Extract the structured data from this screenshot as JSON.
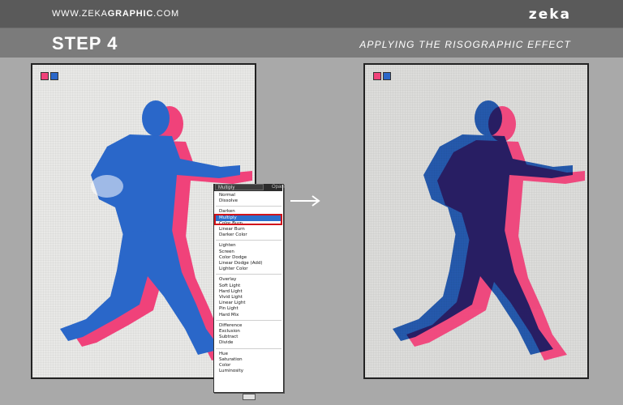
{
  "header": {
    "site_prefix": "WWW.ZEKA",
    "site_bold": "GRAPHIC",
    "site_suffix": ".COM",
    "logo": "zeka"
  },
  "step": {
    "title": "STEP 4",
    "subtitle": "APPLYING THE RISOGRAPHIC EFFECT"
  },
  "panels": {
    "left": {
      "swatch_colors": [
        "#f0427a",
        "#2a67c9"
      ]
    },
    "right": {
      "swatch_colors": [
        "#f0427a",
        "#2a67c9"
      ]
    }
  },
  "blend_menu": {
    "selected": "Multiply",
    "opacity_label": "Opaci",
    "groups": [
      [
        "Normal",
        "Dissolve"
      ],
      [
        "Darken",
        "Multiply",
        "Color Burn",
        "Linear Burn",
        "Darker Color"
      ],
      [
        "Lighten",
        "Screen",
        "Color Dodge",
        "Linear Dodge (Add)",
        "Lighter Color"
      ],
      [
        "Overlay",
        "Soft Light",
        "Hard Light",
        "Vivid Light",
        "Linear Light",
        "Pin Light",
        "Hard Mix"
      ],
      [
        "Difference",
        "Exclusion",
        "Subtract",
        "Divide"
      ],
      [
        "Hue",
        "Saturation",
        "Color",
        "Luminosity"
      ]
    ]
  },
  "colors": {
    "pink": "#f0427a",
    "blue": "#2a67c9",
    "purple": "#6a2d8f",
    "highlight": "#d1151b"
  }
}
